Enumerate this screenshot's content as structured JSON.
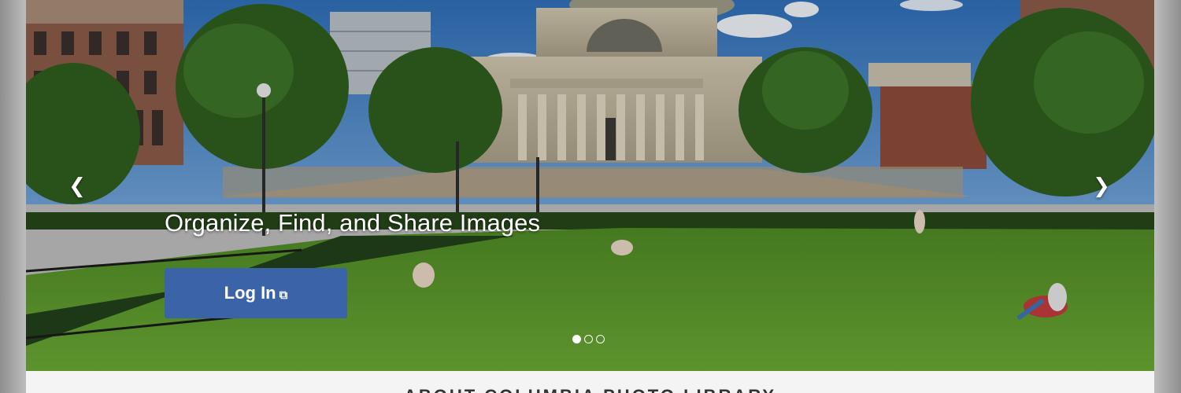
{
  "hero": {
    "tagline": "Organize, Find, and Share Images",
    "login_label": "Log In",
    "login_icon": "external-link-icon",
    "prev_icon": "chevron-left-icon",
    "next_icon": "chevron-right-icon",
    "prev_glyph": "❮",
    "next_glyph": "❯",
    "external_glyph": "⧉",
    "slide_count": 3,
    "active_slide": 1,
    "image": "Campus library building with columns, lawn and trees under a blue sky"
  },
  "about": {
    "title": "ABOUT COLUMBIA PHOTO LIBRARY"
  },
  "colors": {
    "button": "#3b63a8",
    "sky": "#3f7fc4",
    "lawn": "#5e9a2c",
    "section_bg": "#f4f4f4"
  }
}
